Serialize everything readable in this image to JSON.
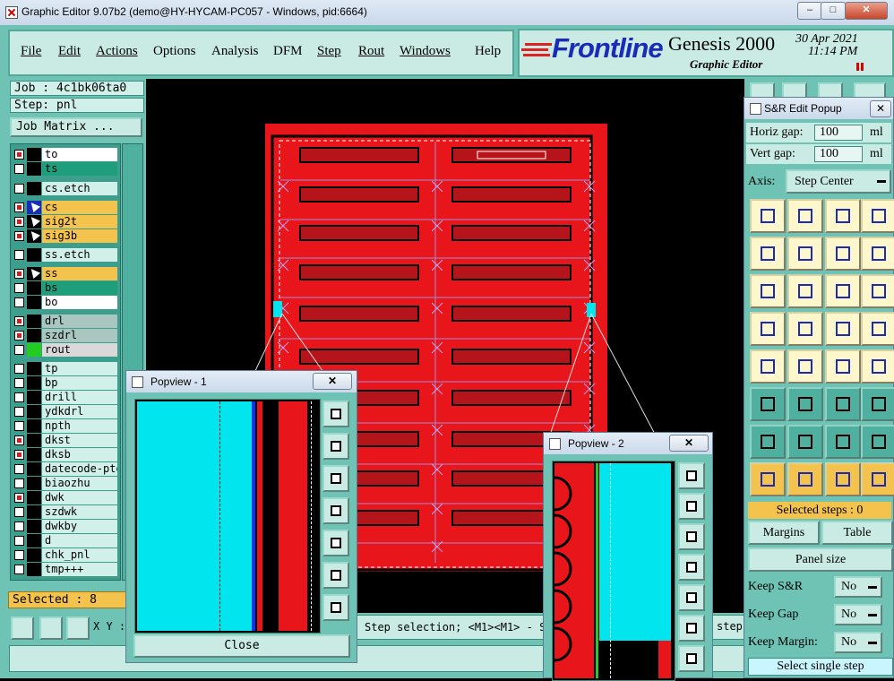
{
  "window": {
    "title": "Graphic Editor 9.07b2 (demo@HY-HYCAM-PC057 - Windows, pid:6664)"
  },
  "menu": {
    "items": [
      "File",
      "Edit",
      "Actions",
      "Options",
      "Analysis",
      "DFM",
      "Step",
      "Rout",
      "Windows",
      "Help"
    ]
  },
  "brand": {
    "logo": "Frontline",
    "product": "Genesis 2000",
    "subtitle": "Graphic Editor",
    "date": "30 Apr 2021",
    "time": "11:14 PM"
  },
  "job": {
    "job_label": "Job : 4c1bk06ta0",
    "step_label": "Step: pnl",
    "matrix_button": "Job Matrix ..."
  },
  "layers": [
    {
      "name": "to",
      "color": "#ffffff",
      "checked": true,
      "swatch": "#000000"
    },
    {
      "name": "ts",
      "color": "#1f9e7c",
      "checked": false,
      "swatch": "#000000"
    },
    {
      "name": "cs.etch",
      "color": "#d2f0ea",
      "checked": false,
      "swatch": "#000000"
    },
    {
      "name": "cs",
      "color": "#f3c34e",
      "checked": true,
      "swatch": "#1a2bb8"
    },
    {
      "name": "sig2t",
      "color": "#f3c34e",
      "checked": true,
      "swatch": "#000000"
    },
    {
      "name": "sig3b",
      "color": "#f3c34e",
      "checked": true,
      "swatch": "#000000"
    },
    {
      "name": "ss.etch",
      "color": "#d2f0ea",
      "checked": false,
      "swatch": "#000000"
    },
    {
      "name": "ss",
      "color": "#f3c34e",
      "checked": true,
      "swatch": "#000000"
    },
    {
      "name": "bs",
      "color": "#1f9e7c",
      "checked": false,
      "swatch": "#000000"
    },
    {
      "name": "bo",
      "color": "#ffffff",
      "checked": false,
      "swatch": "#000000"
    },
    {
      "name": "drl",
      "color": "#a9c7c0",
      "checked": true,
      "swatch": "#000000"
    },
    {
      "name": "szdrl",
      "color": "#a9c7c0",
      "checked": true,
      "swatch": "#000000"
    },
    {
      "name": "rout",
      "color": "#d9d9d9",
      "checked": false,
      "swatch": "#22cc22"
    },
    {
      "name": "tp",
      "color": "#d2f0ea",
      "checked": false,
      "swatch": "#000000"
    },
    {
      "name": "bp",
      "color": "#d2f0ea",
      "checked": false,
      "swatch": "#000000"
    },
    {
      "name": "drill",
      "color": "#d2f0ea",
      "checked": false,
      "swatch": "#000000"
    },
    {
      "name": "ydkdrl",
      "color": "#d2f0ea",
      "checked": false,
      "swatch": "#000000"
    },
    {
      "name": "npth",
      "color": "#d2f0ea",
      "checked": false,
      "swatch": "#000000"
    },
    {
      "name": "dkst",
      "color": "#d2f0ea",
      "checked": true,
      "swatch": "#000000"
    },
    {
      "name": "dksb",
      "color": "#d2f0ea",
      "checked": true,
      "swatch": "#000000"
    },
    {
      "name": "datecode-pte",
      "color": "#d2f0ea",
      "checked": false,
      "swatch": "#000000"
    },
    {
      "name": "biaozhu",
      "color": "#d2f0ea",
      "checked": false,
      "swatch": "#000000"
    },
    {
      "name": "dwk",
      "color": "#d2f0ea",
      "checked": true,
      "swatch": "#000000"
    },
    {
      "name": "szdwk",
      "color": "#d2f0ea",
      "checked": false,
      "swatch": "#000000"
    },
    {
      "name": "dwkby",
      "color": "#d2f0ea",
      "checked": false,
      "swatch": "#000000"
    },
    {
      "name": "d",
      "color": "#d2f0ea",
      "checked": false,
      "swatch": "#000000"
    },
    {
      "name": "chk_pnl",
      "color": "#d2f0ea",
      "checked": false,
      "swatch": "#000000"
    },
    {
      "name": "tmp+++",
      "color": "#d2f0ea",
      "checked": false,
      "swatch": "#000000"
    }
  ],
  "status": {
    "selected": "Selected : 8",
    "xy": "X Y :",
    "message": "Step selection; <M1><M1> - S",
    "message2": "step"
  },
  "sr_popup": {
    "title": "S&R Edit Popup",
    "horiz_label": "Horiz gap:",
    "horiz_value": "100",
    "horiz_unit": "ml",
    "vert_label": "Vert  gap:",
    "vert_value": "100",
    "vert_unit": "ml",
    "axis_label": "Axis:",
    "axis_value": "Step Center",
    "selected_steps": "Selected steps : 0",
    "margins": "Margins",
    "table": "Table",
    "panel_size": "Panel size",
    "keep_sr_label": "Keep S&R",
    "keep_sr_value": "No",
    "keep_gap_label": "Keep Gap",
    "keep_gap_value": "No",
    "keep_margin_label": "Keep Margin:",
    "keep_margin_value": "No",
    "select_single": "Select single step"
  },
  "popview1": {
    "title": "Popview - 1",
    "close": "Close"
  },
  "popview2": {
    "title": "Popview - 2"
  },
  "colors": {
    "panel_red": "#e8151b",
    "teal": "#6ec3b4",
    "cyan": "#00e5ee"
  }
}
